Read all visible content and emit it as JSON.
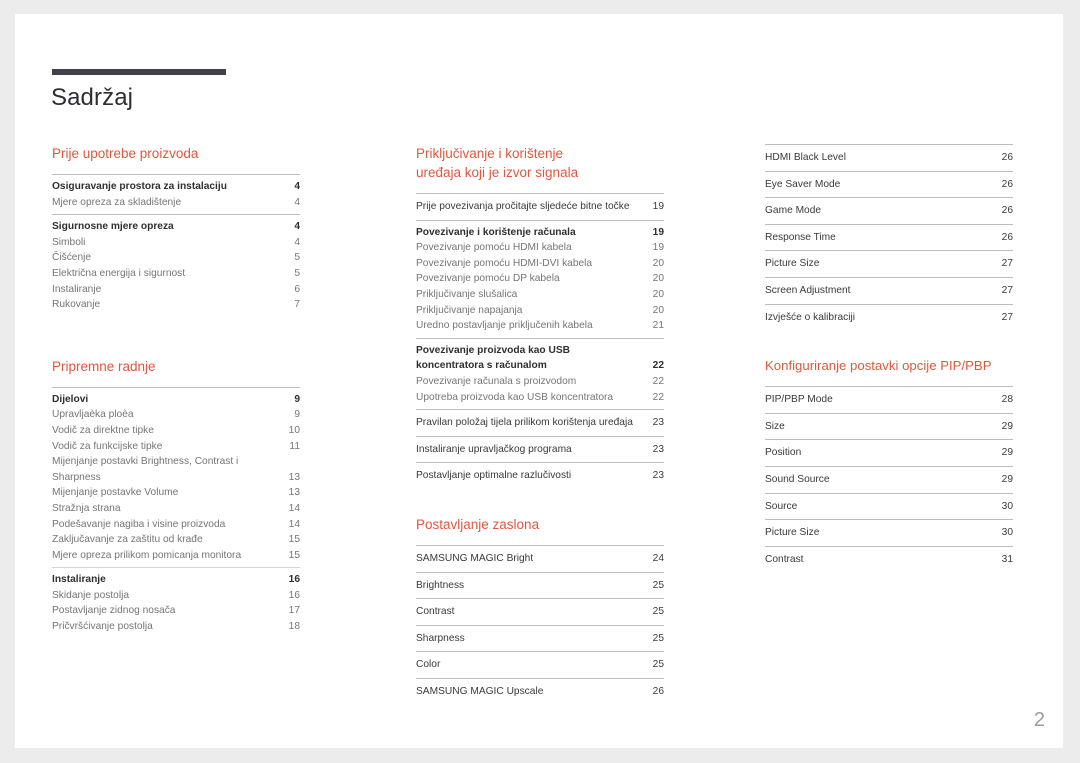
{
  "document": {
    "title": "Sadržaj",
    "page_number": "2",
    "accent_color": "#e0573f",
    "title_rule_color": "#403f4a",
    "folio_color": "#9a9aa4"
  },
  "columns": [
    {
      "id": "column-1",
      "sections": [
        {
          "heading": "Prije upotrebe proizvoda",
          "groups": [
            {
              "rule": "gray",
              "entries": [
                {
                  "label": "Osiguravanje prostora za instalaciju",
                  "page": "4",
                  "style": "lead"
                },
                {
                  "label": "Mjere opreza za skladištenje",
                  "page": "4",
                  "style": "sub"
                }
              ]
            },
            {
              "rule": "gray",
              "entries": [
                {
                  "label": "Sigurnosne mjere opreza",
                  "page": "4",
                  "style": "lead"
                },
                {
                  "label": "Simboli",
                  "page": "4",
                  "style": "sub"
                },
                {
                  "label": "Čišćenje",
                  "page": "5",
                  "style": "sub"
                },
                {
                  "label": "Električna energija i sigurnost",
                  "page": "5",
                  "style": "sub"
                },
                {
                  "label": "Instaliranje",
                  "page": "6",
                  "style": "sub"
                },
                {
                  "label": "Rukovanje",
                  "page": "7",
                  "style": "sub"
                }
              ]
            }
          ]
        },
        {
          "heading": "Pripremne radnje",
          "groups": [
            {
              "rule": "gray",
              "entries": [
                {
                  "label": "Dijelovi",
                  "page": "9",
                  "style": "lead"
                },
                {
                  "label": "Upravljaèka ploèa",
                  "page": "9",
                  "style": "sub"
                },
                {
                  "label": "Vodič za direktne tipke",
                  "page": "10",
                  "style": "sub"
                },
                {
                  "label": "Vodič za funkcijske tipke",
                  "page": "11",
                  "style": "sub"
                },
                {
                  "label": "Mijenjanje postavki Brightness, Contrast i Sharpness",
                  "page": "13",
                  "style": "sub",
                  "wrap": true
                },
                {
                  "label": "Mijenjanje postavke Volume",
                  "page": "13",
                  "style": "sub"
                },
                {
                  "label": "Stražnja strana",
                  "page": "14",
                  "style": "sub"
                },
                {
                  "label": "Podešavanje nagiba i visine proizvoda",
                  "page": "14",
                  "style": "sub"
                },
                {
                  "label": "Zaključavanje za zaštitu od krađe",
                  "page": "15",
                  "style": "sub"
                },
                {
                  "label": "Mjere opreza prilikom pomicanja monitora",
                  "page": "15",
                  "style": "sub"
                }
              ]
            },
            {
              "rule": "pink",
              "entries": [
                {
                  "label": "Instaliranje",
                  "page": "16",
                  "style": "lead"
                },
                {
                  "label": "Skidanje postolja",
                  "page": "16",
                  "style": "sub"
                },
                {
                  "label": "Postavljanje zidnog nosača",
                  "page": "17",
                  "style": "sub"
                },
                {
                  "label": "Pričvršćivanje postolja",
                  "page": "18",
                  "style": "sub"
                }
              ]
            }
          ]
        }
      ]
    },
    {
      "id": "column-2",
      "sections": [
        {
          "heading": "Priključivanje i korištenje\nuređaja koji je izvor signala",
          "groups": [
            {
              "rule": "gray",
              "entries": [
                {
                  "label": "Prije povezivanja pročitajte sljedeće bitne točke",
                  "page": "19",
                  "style": "plain"
                }
              ]
            },
            {
              "rule": "gray",
              "entries": [
                {
                  "label": "Povezivanje i korištenje računala",
                  "page": "19",
                  "style": "lead"
                },
                {
                  "label": "Povezivanje pomoću HDMI kabela",
                  "page": "19",
                  "style": "sub"
                },
                {
                  "label": "Povezivanje pomoću HDMI-DVI kabela",
                  "page": "20",
                  "style": "sub"
                },
                {
                  "label": "Povezivanje pomoću DP kabela",
                  "page": "20",
                  "style": "sub"
                },
                {
                  "label": "Priključivanje slušalica",
                  "page": "20",
                  "style": "sub"
                },
                {
                  "label": "Priključivanje napajanja",
                  "page": "20",
                  "style": "sub"
                },
                {
                  "label": "Uredno postavljanje priključenih kabela",
                  "page": "21",
                  "style": "sub"
                }
              ]
            },
            {
              "rule": "gray",
              "entries": [
                {
                  "label": "Povezivanje proizvoda kao USB koncentratora s računalom",
                  "page": "22",
                  "style": "lead",
                  "wrap": true
                },
                {
                  "label": "Povezivanje računala s proizvodom",
                  "page": "22",
                  "style": "sub"
                },
                {
                  "label": "Upotreba proizvoda kao USB koncentratora",
                  "page": "22",
                  "style": "sub"
                }
              ]
            },
            {
              "rule": "gray",
              "entries": [
                {
                  "label": "Pravilan položaj tijela prilikom korištenja uređaja",
                  "page": "23",
                  "style": "plain"
                }
              ]
            },
            {
              "rule": "gray",
              "entries": [
                {
                  "label": "Instaliranje upravljačkog programa",
                  "page": "23",
                  "style": "plain"
                }
              ]
            },
            {
              "rule": "gray",
              "entries": [
                {
                  "label": "Postavljanje optimalne razlučivosti",
                  "page": "23",
                  "style": "plain"
                }
              ]
            }
          ]
        },
        {
          "heading": "Postavljanje zaslona",
          "groups": [
            {
              "rule": "gray",
              "entries": [
                {
                  "label": "SAMSUNG MAGIC Bright",
                  "page": "24",
                  "style": "plain"
                }
              ]
            },
            {
              "rule": "gray",
              "entries": [
                {
                  "label": "Brightness",
                  "page": "25",
                  "style": "plain"
                }
              ]
            },
            {
              "rule": "gray",
              "entries": [
                {
                  "label": "Contrast",
                  "page": "25",
                  "style": "plain"
                }
              ]
            },
            {
              "rule": "gray",
              "entries": [
                {
                  "label": "Sharpness",
                  "page": "25",
                  "style": "plain"
                }
              ]
            },
            {
              "rule": "gray",
              "entries": [
                {
                  "label": "Color",
                  "page": "25",
                  "style": "plain"
                }
              ]
            },
            {
              "rule": "gray",
              "entries": [
                {
                  "label": "SAMSUNG MAGIC Upscale",
                  "page": "26",
                  "style": "plain"
                }
              ]
            }
          ]
        }
      ]
    },
    {
      "id": "column-3",
      "sections": [
        {
          "heading": "",
          "groups": [
            {
              "rule": "gray",
              "entries": [
                {
                  "label": "HDMI Black Level",
                  "page": "26",
                  "style": "plain"
                }
              ]
            },
            {
              "rule": "gray",
              "entries": [
                {
                  "label": "Eye Saver Mode",
                  "page": "26",
                  "style": "plain"
                }
              ]
            },
            {
              "rule": "gray",
              "entries": [
                {
                  "label": "Game Mode",
                  "page": "26",
                  "style": "plain"
                }
              ]
            },
            {
              "rule": "gray",
              "entries": [
                {
                  "label": "Response Time",
                  "page": "26",
                  "style": "plain"
                }
              ]
            },
            {
              "rule": "gray",
              "entries": [
                {
                  "label": "Picture Size",
                  "page": "27",
                  "style": "plain"
                }
              ]
            },
            {
              "rule": "gray",
              "entries": [
                {
                  "label": "Screen Adjustment",
                  "page": "27",
                  "style": "plain"
                }
              ]
            },
            {
              "rule": "gray",
              "entries": [
                {
                  "label": "Izvješće o kalibraciji",
                  "page": "27",
                  "style": "plain"
                }
              ]
            }
          ]
        },
        {
          "heading": "Konfiguriranje postavki opcije PIP/PBP",
          "groups": [
            {
              "rule": "gray",
              "entries": [
                {
                  "label": "PIP/PBP Mode",
                  "page": "28",
                  "style": "plain"
                }
              ]
            },
            {
              "rule": "gray",
              "entries": [
                {
                  "label": "Size",
                  "page": "29",
                  "style": "plain"
                }
              ]
            },
            {
              "rule": "gray",
              "entries": [
                {
                  "label": "Position",
                  "page": "29",
                  "style": "plain"
                }
              ]
            },
            {
              "rule": "gray",
              "entries": [
                {
                  "label": "Sound Source",
                  "page": "29",
                  "style": "plain"
                }
              ]
            },
            {
              "rule": "gray",
              "entries": [
                {
                  "label": "Source",
                  "page": "30",
                  "style": "plain"
                }
              ]
            },
            {
              "rule": "gray",
              "entries": [
                {
                  "label": "Picture Size",
                  "page": "30",
                  "style": "plain"
                }
              ]
            },
            {
              "rule": "gray",
              "entries": [
                {
                  "label": "Contrast",
                  "page": "31",
                  "style": "plain"
                }
              ]
            }
          ]
        }
      ]
    }
  ]
}
